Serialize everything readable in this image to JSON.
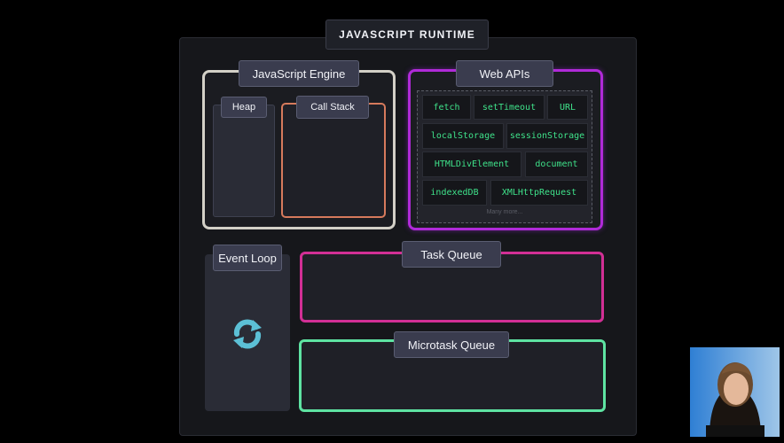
{
  "runtime": {
    "title": "JAVASCRIPT RUNTIME"
  },
  "engine": {
    "title": "JavaScript Engine",
    "heap_label": "Heap",
    "callstack_label": "Call Stack"
  },
  "webapis": {
    "title": "Web APIs",
    "items": [
      "fetch",
      "setTimeout",
      "URL",
      "localStorage",
      "sessionStorage",
      "HTMLDivElement",
      "document",
      "indexedDB",
      "XMLHttpRequest"
    ],
    "more": "Many more..."
  },
  "eventloop": {
    "title": "Event Loop",
    "icon": "refresh-loop-icon"
  },
  "task_queue": {
    "title": "Task Queue"
  },
  "microtask_queue": {
    "title": "Microtask Queue"
  },
  "colors": {
    "engine_border": "#d3d0c7",
    "callstack_border": "#d67a5c",
    "webapis_border": "#b02ad8",
    "api_text": "#3fe28a",
    "task_queue_border": "#d22f95",
    "microtask_queue_border": "#5ee3a2",
    "loop_icon": "#5cc0d6"
  }
}
